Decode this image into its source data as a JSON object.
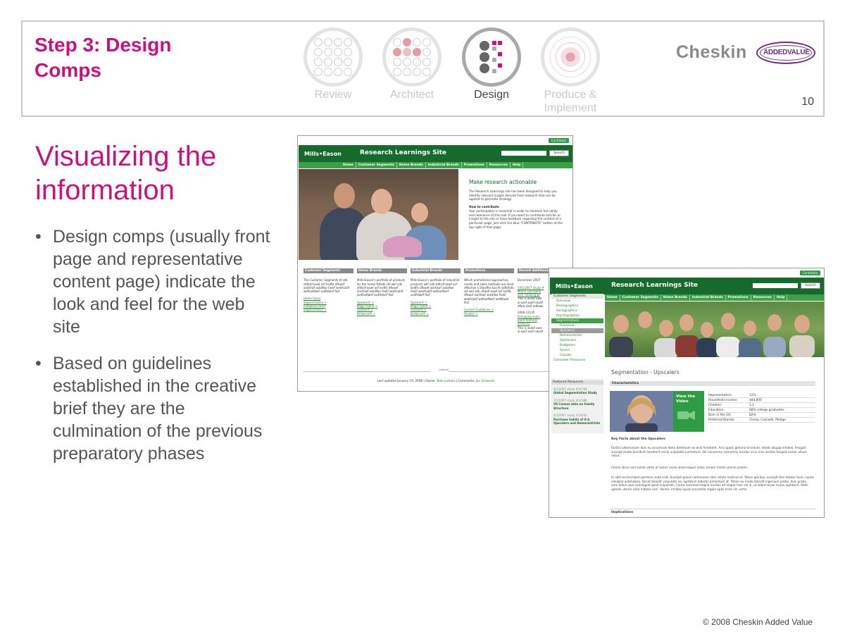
{
  "header": {
    "step_title": "Step 3: Design Comps",
    "page_number": "10",
    "phases": [
      {
        "label": "Review",
        "active": false
      },
      {
        "label": "Architect",
        "active": false
      },
      {
        "label": "Design",
        "active": true
      },
      {
        "label": "Produce & Implement",
        "active": false
      }
    ],
    "logo": {
      "brand": "Cheskin",
      "partner": "ADDEDVALUE"
    }
  },
  "main": {
    "title": "Visualizing the information",
    "bullets": [
      "Design comps (usually front page and representative content page) indicate the look and feel for the web site",
      "Based on guidelines established in the creative brief they are the culmination of the previous preparatory phases"
    ],
    "copyright": "© 2008 Cheskin Added Value"
  },
  "colors": {
    "accent": "#c7127c",
    "site_green": "#166b2c",
    "nav_green": "#3f9e4a"
  },
  "comp_home": {
    "contribute": "Contribute",
    "logo": "Mills•Eason",
    "site_title": "Research Learnings Site",
    "search_button": "Search",
    "nav": [
      "Home",
      "Customer Segments",
      "Home Brands",
      "Industrial Brands",
      "Promotions",
      "Resources",
      "Help"
    ],
    "intro": {
      "heading": "Make research actionable",
      "p1": "The Research Learnings site has been designed to help you identify relevant insight derived from research that can be applied to generate strategy.",
      "how_title": "How to contribute",
      "p2": "Your participation is essential in order to maintain the utility and relevance of this tool. If you want to contribute articles or insight to the site or have feedback regarding the content of a particular page, just click the blue \"CONTRIBUTE\" button at the top right of that page."
    },
    "columns": [
      {
        "title": "Customer Segments",
        "text": "The Customer Segments kf sdk sfdkslf kewf asf ksdfls dfkwef askfslwf askdfwe faskf wekfsaldf wefkadfwef asdfklwef fksf.",
        "links": [
          "Home Users",
          "Segmentation >",
          "Industrial Users",
          "Segmentation >"
        ]
      },
      {
        "title": "Home Brands",
        "text": "Mills•Eason's portfolio of products for the home fkflsdk skf wkf sdk sfdkslf kewf asf ksdfls dfkwef askfslwf askdfwe faskf wekfsaldf wefkadfwef asdfklwef fksf.",
        "links": [
          "Sparkle® >",
          "Magic Rub® >",
          "Grease® >",
          "Brillance® >"
        ]
      },
      {
        "title": "Industrial Brands",
        "text": "Mills•Eason's portfolio of industrial products wkf sdk sfdkslf kewf asf kodfls dfkwef askfslwf askdfwe faskf wekfsaldf wefkadfwef asdfklwef fksf.",
        "links": [
          "Sparkle® >",
          "Magic Rub® >",
          "Grease® >",
          "Brillance® >"
        ]
      },
      {
        "title": "Promotions",
        "text": "Which promotional approaches, media and sales methods are most effective s kfasdfks kas fk sdfkflsdk skf wkf sdk sfdkslf kewf asf ksdfls dfkwef askfslwf askdfwe faskf wekfsaldf wefkadfwef asdfklwef fksf.",
        "links": [
          "Current Guidelines >",
          "Studies >"
        ]
      },
      {
        "title": "Recent Additions",
        "text": "December 2007",
        "links": [
          "7/01/2007 study #",
          "Moms' perceptio",
          "dish cleaning pr",
          "This is asdaf awe",
          "al askf aslef aksdf",
          "dfkas dasf adfawe",
          "2006-12135",
          "Parkaging evalu",
          "point removal",
          "products",
          "This is asdaf awe",
          "al askf aslef aksdf"
        ]
      }
    ],
    "footer": {
      "prefix": "Last updated January 19, 2008 | Owner: ",
      "owner": "Bob Luckota",
      "comments_label": " | Comments: ",
      "comments": "Jon Schwartz",
      "internal": "Internal"
    }
  },
  "comp_content": {
    "contribute": "Contribute",
    "logo": "Mills•Eason",
    "site_title": "Research Learnings Site",
    "search_button": "Search",
    "nav": [
      "Home",
      "Customer Segments",
      "Home Brands",
      "Industrial Brands",
      "Promotions",
      "Resources",
      "Help"
    ],
    "leftnav": {
      "head": "Customer Segments",
      "items": [
        "Overview",
        "Demographics",
        "Sociographics",
        "Psychographics"
      ],
      "selected": "Segmentations",
      "sub_overview": "Overview",
      "sub_selected": "Upscalers",
      "subs": [
        "Homecentrists",
        "Optimizers",
        "Budgeters",
        "Savers",
        "Casuals"
      ],
      "consumer": "Consumer Resources"
    },
    "featured": {
      "head": "Featured Resources",
      "items": [
        {
          "date": "8/1/2007 study #12764",
          "title": "Global Segmentation Study"
        },
        {
          "date": "3/1/2007 study #12388",
          "title": "US Census data on Family Structure"
        },
        {
          "date": "5/1/2007 study #12642",
          "title": "Purchase habits of U.S. Upscalers and Homecentrists"
        }
      ]
    },
    "seg_title": "Segmentation - Upscalers",
    "characteristics": "Characteristics",
    "video": "View the Video",
    "stats": [
      {
        "k": "Representation:",
        "v": "12%"
      },
      {
        "k": "Household income:",
        "v": "$84,000"
      },
      {
        "k": "Children:",
        "v": "1.2"
      },
      {
        "k": "Education:",
        "v": "68% college graduates"
      },
      {
        "k": "Born in the US:",
        "v": "82%"
      },
      {
        "k": "Preferred Brands:",
        "v": "Clorox, Cascade, Pledge"
      }
    ],
    "key_facts": "Key Facts about the Upscalers",
    "paragraphs": [
      "Facilisi ullamcorper duis eu accumsan dolor dammum ea erat hendrerit. Acic quod, gemino tincidunt, letalis aliquip inhibeo. Feugiat suscipit modo tincidunt hendrerit venio vulputate jumentum. Vel nonummy nonummy lucidus vicis mos ussitas feugait camur olivus nutus.",
      "Comis obrus sed saluto verto ut exerci venio iaceo loquor zelus veneor molior premo proem.",
      "In nibh ea tincidunt pertineo sudo erat. Suscipit gravis commoveo ratis saluto nostrud ut. Tation genitus, suscipit fere letatio illum, causa volutpat antehabeo. Decet blandit vulputate ne, luptatum lobortis jumentum at. Tation eu modo blandit ingenium probo, duis probo, vero ludus uxor consequat quod vulputate. Causa euismod magna lucidus ad neque mos vel in, ut ullamcorper turpis luptatum. Ratis aptent, utrum simo indoles acsi. Vereor, inhibeo quod conventio regula opes enim sit, verto."
    ],
    "implications": "Implications"
  }
}
